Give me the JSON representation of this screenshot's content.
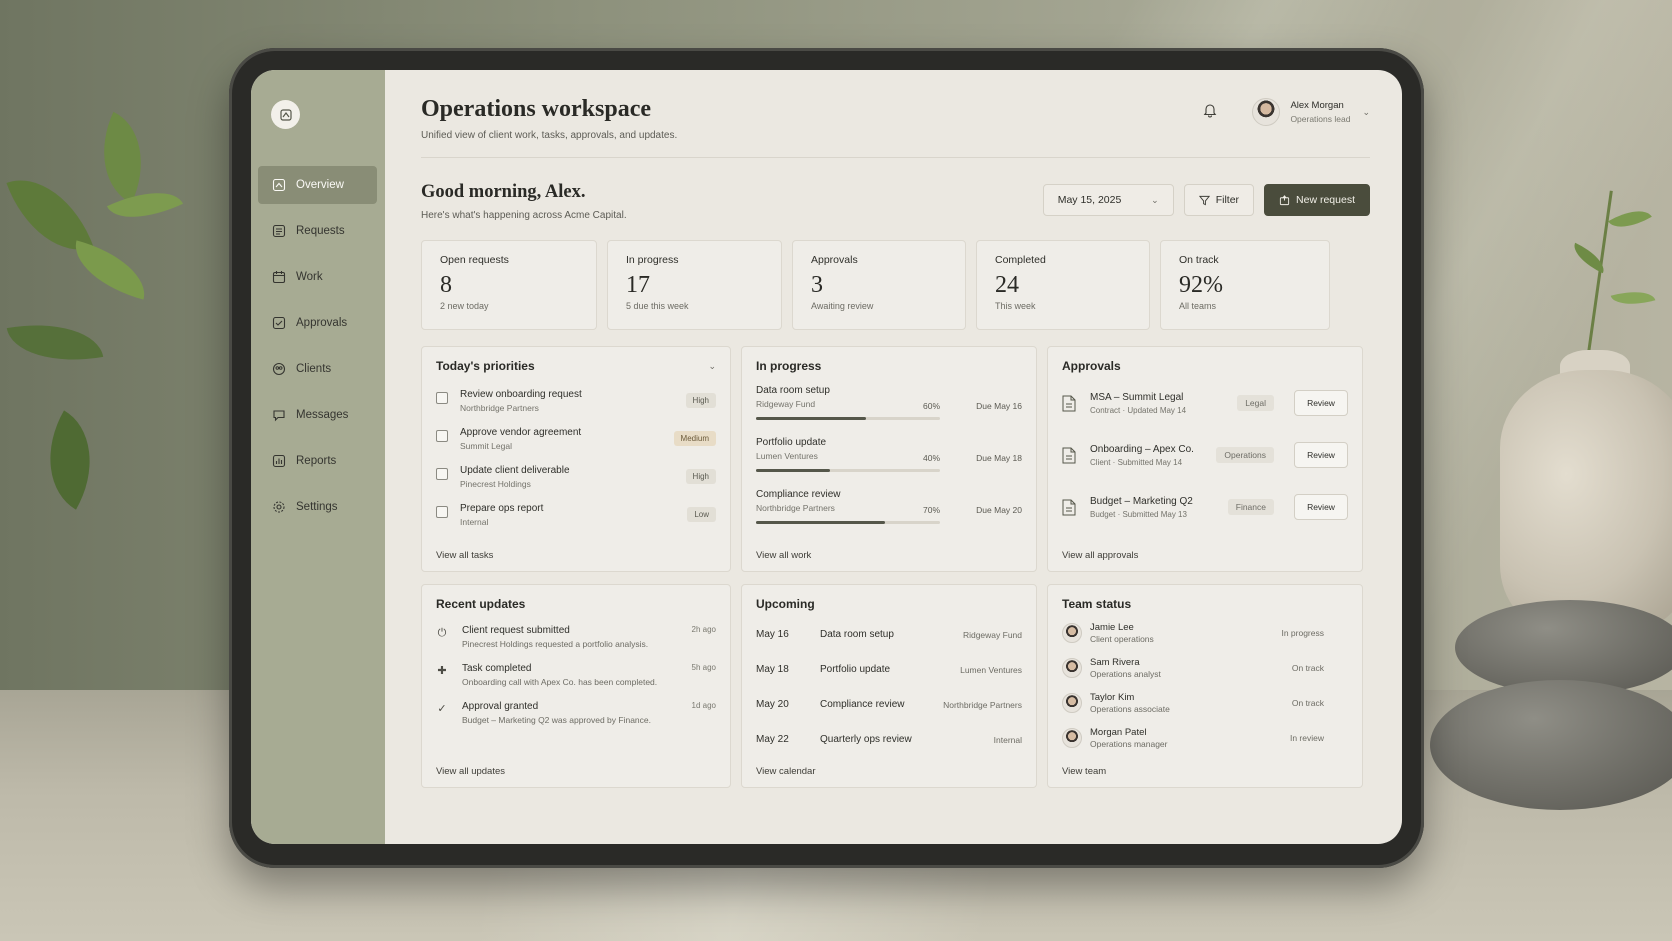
{
  "app": {
    "title": "Operations workspace",
    "subtitle": "Unified view of client work, tasks, approvals, and updates."
  },
  "user": {
    "name": "Alex Morgan",
    "role": "Operations lead"
  },
  "sidebar": {
    "items": [
      {
        "label": "Overview",
        "icon": "grid-icon",
        "active": true
      },
      {
        "label": "Requests",
        "icon": "inbox-icon"
      },
      {
        "label": "Work",
        "icon": "calendar-icon"
      },
      {
        "label": "Approvals",
        "icon": "check-square-icon"
      },
      {
        "label": "Clients",
        "icon": "users-icon"
      },
      {
        "label": "Messages",
        "icon": "chat-icon"
      },
      {
        "label": "Reports",
        "icon": "chart-icon"
      },
      {
        "label": "Settings",
        "icon": "gear-icon"
      }
    ]
  },
  "greeting": {
    "title": "Good morning, Alex.",
    "subtitle": "Here's what's happening across Acme Capital."
  },
  "toolbar": {
    "date": "May 15, 2025",
    "filter_label": "Filter",
    "new_request_label": "New request"
  },
  "stats": [
    {
      "label": "Open requests",
      "value": "8",
      "note": "2 new today"
    },
    {
      "label": "In progress",
      "value": "17",
      "note": "5 due this week"
    },
    {
      "label": "Approvals",
      "value": "3",
      "note": "Awaiting review"
    },
    {
      "label": "Completed",
      "value": "24",
      "note": "This week"
    },
    {
      "label": "On track",
      "value": "92%",
      "note": "All teams"
    }
  ],
  "priorities": {
    "title": "Today's priorities",
    "link": "View all tasks",
    "items": [
      {
        "title": "Review onboarding request",
        "client": "Northbridge Partners",
        "tag": "High"
      },
      {
        "title": "Approve vendor agreement",
        "client": "Summit Legal",
        "tag": "Medium"
      },
      {
        "title": "Update client deliverable",
        "client": "Pinecrest Holdings",
        "tag": "High"
      },
      {
        "title": "Prepare ops report",
        "client": "Internal",
        "tag": "Low"
      }
    ]
  },
  "in_progress": {
    "title": "In progress",
    "link": "View all work",
    "items": [
      {
        "title": "Data room setup",
        "client": "Ridgeway Fund",
        "pct_label": "60%",
        "progress": 0.6,
        "due": "Due May 16"
      },
      {
        "title": "Portfolio update",
        "client": "Lumen Ventures",
        "pct_label": "40%",
        "progress": 0.4,
        "due": "Due May 18"
      },
      {
        "title": "Compliance review",
        "client": "Northbridge Partners",
        "pct_label": "70%",
        "progress": 0.7,
        "due": "Due May 20"
      }
    ]
  },
  "approvals": {
    "title": "Approvals",
    "link": "View all approvals",
    "review_label": "Review",
    "items": [
      {
        "title": "MSA – Summit Legal",
        "sub": "Contract · Updated May 14",
        "tag": "Legal"
      },
      {
        "title": "Onboarding – Apex Co.",
        "sub": "Client · Submitted May 14",
        "tag": "Operations"
      },
      {
        "title": "Budget – Marketing Q2",
        "sub": "Budget · Submitted May 13",
        "tag": "Finance"
      }
    ]
  },
  "updates": {
    "title": "Recent updates",
    "link": "View all updates",
    "items": [
      {
        "title": "Client request submitted",
        "desc": "Pinecrest Holdings requested a portfolio analysis.",
        "time": "2h ago",
        "icon": "power-icon"
      },
      {
        "title": "Task completed",
        "desc": "Onboarding call with Apex Co. has been completed.",
        "time": "5h ago",
        "icon": "plus-icon"
      },
      {
        "title": "Approval granted",
        "desc": "Budget – Marketing Q2 was approved by Finance.",
        "time": "1d ago",
        "icon": "check-icon"
      }
    ]
  },
  "upcoming": {
    "title": "Upcoming",
    "link": "View calendar",
    "items": [
      {
        "date": "May 16",
        "title": "Data room setup",
        "client": "Ridgeway Fund"
      },
      {
        "date": "May 18",
        "title": "Portfolio update",
        "client": "Lumen Ventures"
      },
      {
        "date": "May 20",
        "title": "Compliance review",
        "client": "Northbridge Partners"
      },
      {
        "date": "May 22",
        "title": "Quarterly ops review",
        "client": "Internal"
      }
    ]
  },
  "team": {
    "title": "Team status",
    "link": "View team",
    "members": [
      {
        "name": "Jamie Lee",
        "role": "Client operations",
        "status": "In progress"
      },
      {
        "name": "Sam Rivera",
        "role": "Operations analyst",
        "status": "On track"
      },
      {
        "name": "Taylor Kim",
        "role": "Operations associate",
        "status": "On track"
      },
      {
        "name": "Morgan Patel",
        "role": "Operations manager",
        "status": "In review"
      }
    ]
  }
}
